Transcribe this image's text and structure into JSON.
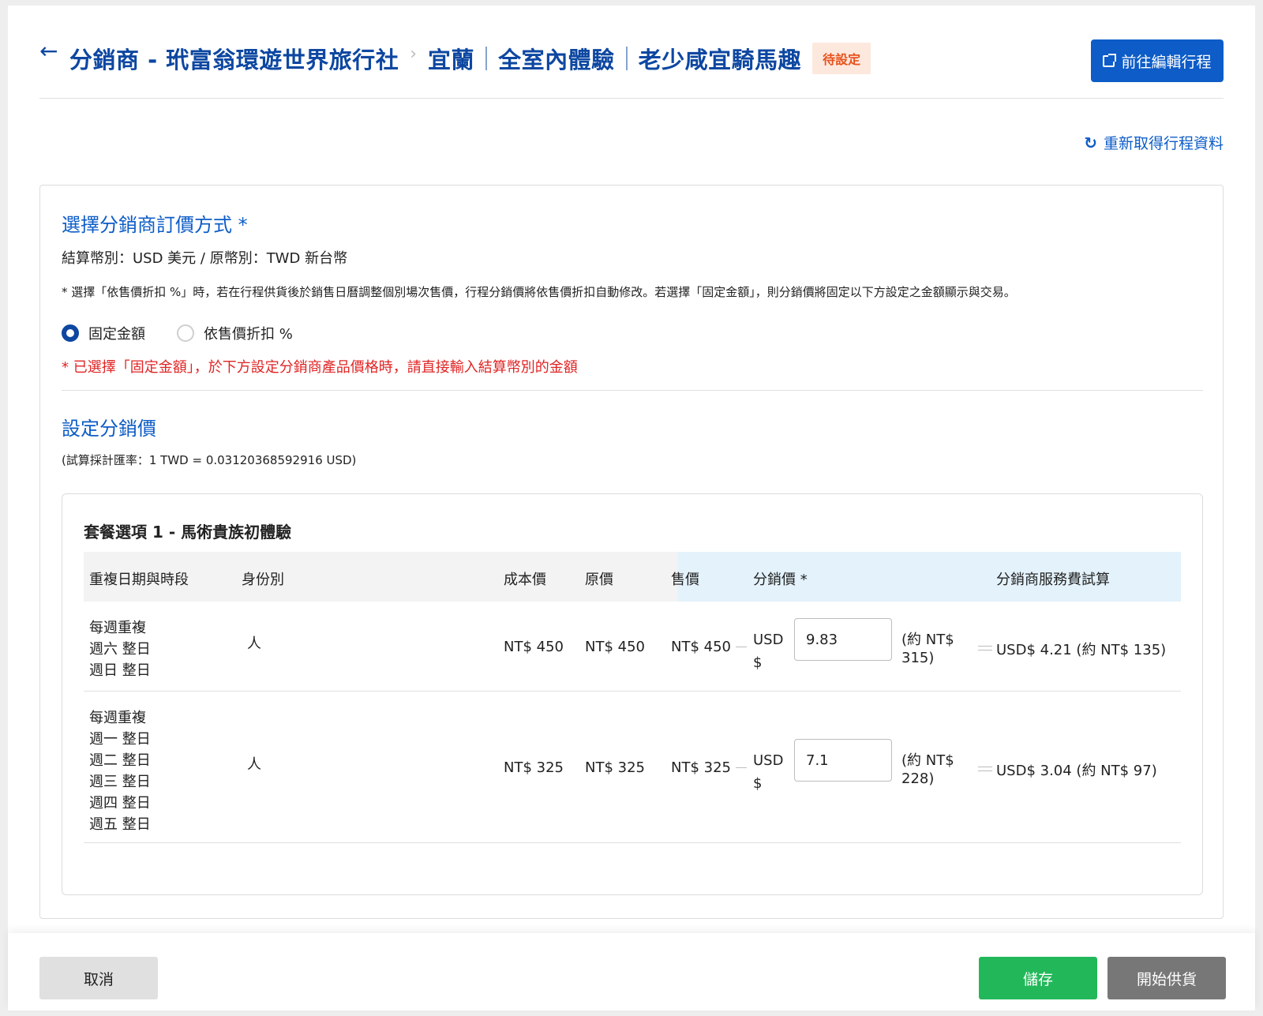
{
  "header": {
    "breadcrumb": [
      "分銷商 - 玳富翁環遊世界旅行社",
      "宜蘭",
      "全室內體驗",
      "老少咸宜騎馬趣"
    ],
    "status_badge": "待設定",
    "edit_button": "前往編輯行程"
  },
  "refresh_label": "重新取得行程資料",
  "pricing_method": {
    "title": "選擇分銷商訂價方式 *",
    "currency_info": "結算幣別：USD 美元 / 原幣別：TWD 新台幣",
    "note": "* 選擇「依售價折扣 %」時，若在行程供貨後於銷售日曆調整個別場次售價，行程分銷價將依售價折扣自動修改。若選擇「固定金額」，則分銷價將固定以下方設定之金額顯示與交易。",
    "options": [
      {
        "label": "固定金額",
        "checked": true
      },
      {
        "label": "依售價折扣 %",
        "checked": false
      }
    ],
    "warning": "* 已選擇「固定金額」，於下方設定分銷商產品價格時，請直接輸入結算幣別的金額"
  },
  "distributor_price": {
    "title": "設定分銷價",
    "rate_note": "(試算採計匯率：1 TWD = 0.03120368592916 USD)"
  },
  "package": {
    "title": "套餐選項 1 - 馬術貴族初體驗",
    "columns": [
      "重複日期與時段",
      "身份別",
      "成本價",
      "原價",
      "售價",
      "分銷價 *",
      "分銷商服務費試算"
    ],
    "rows": [
      {
        "dates": [
          "每週重複",
          "週六 整日",
          "週日 整日"
        ],
        "identity": "人",
        "cost": "NT$ 450",
        "original": "NT$ 450",
        "sale": "NT$ 450",
        "currency_line1": "USD",
        "currency_line2": "$",
        "input_value": "9.83",
        "approx_line1": "(約 NT$",
        "approx_line2": "315)",
        "fee": "USD$ 4.21 (約 NT$ 135)"
      },
      {
        "dates": [
          "每週重複",
          "週一 整日",
          "週二 整日",
          "週三 整日",
          "週四 整日",
          "週五 整日"
        ],
        "identity": "人",
        "cost": "NT$ 325",
        "original": "NT$ 325",
        "sale": "NT$ 325",
        "currency_line1": "USD",
        "currency_line2": "$",
        "input_value": "7.1",
        "approx_line1": "(約 NT$",
        "approx_line2": "228)",
        "fee": "USD$ 3.04 (約 NT$ 97)"
      }
    ]
  },
  "footer": {
    "cancel": "取消",
    "save": "儲存",
    "start_supply": "開始供貨"
  }
}
